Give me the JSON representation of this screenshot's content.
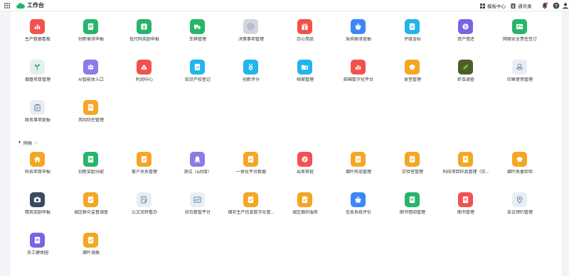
{
  "header": {
    "title": "工作台",
    "template_center": "模板中心",
    "contacts": "通讯录"
  },
  "group": {
    "name": "网格"
  },
  "apps": [
    {
      "label": "生产数据看板",
      "color": "#f2514f",
      "icon": "bar-chart-icon"
    },
    {
      "label": "创新需求申报",
      "color": "#27b56a",
      "icon": "document-icon"
    },
    {
      "label": "低代码奖励申报",
      "color": "#27b56a",
      "icon": "yen-icon"
    },
    {
      "label": "车辆管理",
      "color": "#27b56a",
      "icon": "truck-icon"
    },
    {
      "label": "决策事项管理",
      "color": "#d0d6de",
      "icon": "gear-icon"
    },
    {
      "label": "办公用品",
      "color": "#f2514f",
      "icon": "gift-icon"
    },
    {
      "label": "采购需求提报",
      "color": "#3b87f5",
      "icon": "basket-icon"
    },
    {
      "label": "评级金标",
      "color": "#1fb6ea",
      "icon": "bookmark-icon"
    },
    {
      "label": "资产借还",
      "color": "#7b63e6",
      "icon": "globe-icon"
    },
    {
      "label": "网络安全责任签订",
      "color": "#27b56a",
      "icon": "certificate-icon"
    },
    {
      "label": "烟基项目管理",
      "color": "#e3f1ec",
      "icon": "plant-icon"
    },
    {
      "label": "AI智能体入口",
      "color": "#8c7ae6",
      "icon": "robot-icon"
    },
    {
      "label": "利润中心",
      "color": "#f2514f",
      "icon": "money-bag-icon"
    },
    {
      "label": "知识产权登记",
      "color": "#1fb6ea",
      "icon": "bookmark-icon"
    },
    {
      "label": "创新评分",
      "color": "#1fb6ea",
      "icon": "medal-icon"
    },
    {
      "label": "档案管理",
      "color": "#1fb6ea",
      "icon": "folder-icon"
    },
    {
      "label": "邮箱数字化平台",
      "color": "#f2514f",
      "icon": "bar-chart-icon"
    },
    {
      "label": "食堂管理",
      "color": "#f5a623",
      "icon": "chef-hat-icon"
    },
    {
      "label": "虾虫调查",
      "color": "#4c5e2a",
      "icon": "leaf-photo-icon"
    },
    {
      "label": "印章使用管理",
      "color": "#e9eef5",
      "icon": "stamp-icon"
    },
    {
      "label": "政务事项提报",
      "color": "#e9eef5",
      "icon": "clipboard-icon"
    },
    {
      "label": "风险防控管理",
      "color": "#f5a623",
      "icon": "document-icon"
    },
    {
      "label": "科技项目申报",
      "color": "#f5a623",
      "icon": "home-icon"
    },
    {
      "label": "创新奖励分配",
      "color": "#27b56a",
      "icon": "document-icon"
    },
    {
      "label": "客户关系管理",
      "color": "#f5a623",
      "icon": "bookmark-icon"
    },
    {
      "label": "测试（a对接）",
      "color": "#8c7ae6",
      "icon": "bell-icon"
    },
    {
      "label": "一体化平台数据",
      "color": "#f5a623",
      "icon": "bookmark-icon"
    },
    {
      "label": "出差审批",
      "color": "#f2514f",
      "icon": "globe-icon"
    },
    {
      "label": "烟叶样品管理",
      "color": "#f5a623",
      "icon": "bookmark-icon"
    },
    {
      "label": "实验室管理",
      "color": "#f5a623",
      "icon": "bookmark-icon"
    },
    {
      "label": "科技项目样品管理（仅...",
      "color": "#f5a623",
      "icon": "document-icon"
    },
    {
      "label": "烟叶质量检验",
      "color": "#f5a623",
      "icon": "chef-hat-icon"
    },
    {
      "label": "精英奖励申报",
      "color": "#3a4a63",
      "icon": "camera-icon"
    },
    {
      "label": "城区群众监督调查",
      "color": "#f5a623",
      "icon": "bookmark-icon"
    },
    {
      "label": "公文流转看办",
      "color": "#e9eef5",
      "icon": "file-edit-icon"
    },
    {
      "label": "综合数智平台",
      "color": "#e9eef5",
      "icon": "chart-window-icon"
    },
    {
      "label": "烟农生产信息数字化管...",
      "color": "#f5a623",
      "icon": "bookmark-icon"
    },
    {
      "label": "城区烟农服务",
      "color": "#f5a623",
      "icon": "bookmark-icon"
    },
    {
      "label": "信息系统评价",
      "color": "#3b87f5",
      "icon": "basket-icon"
    },
    {
      "label": "图书借阅管理",
      "color": "#27b56a",
      "icon": "document-icon"
    },
    {
      "label": "图书管理",
      "color": "#f2514f",
      "icon": "document-icon"
    },
    {
      "label": "会议预约管理",
      "color": "#e9eef5",
      "icon": "pin-icon"
    },
    {
      "label": "员工健体园",
      "color": "#7b63e6",
      "icon": "document-icon"
    },
    {
      "label": "烟叶调拨",
      "color": "#f5a623",
      "icon": "bookmark-icon"
    }
  ]
}
